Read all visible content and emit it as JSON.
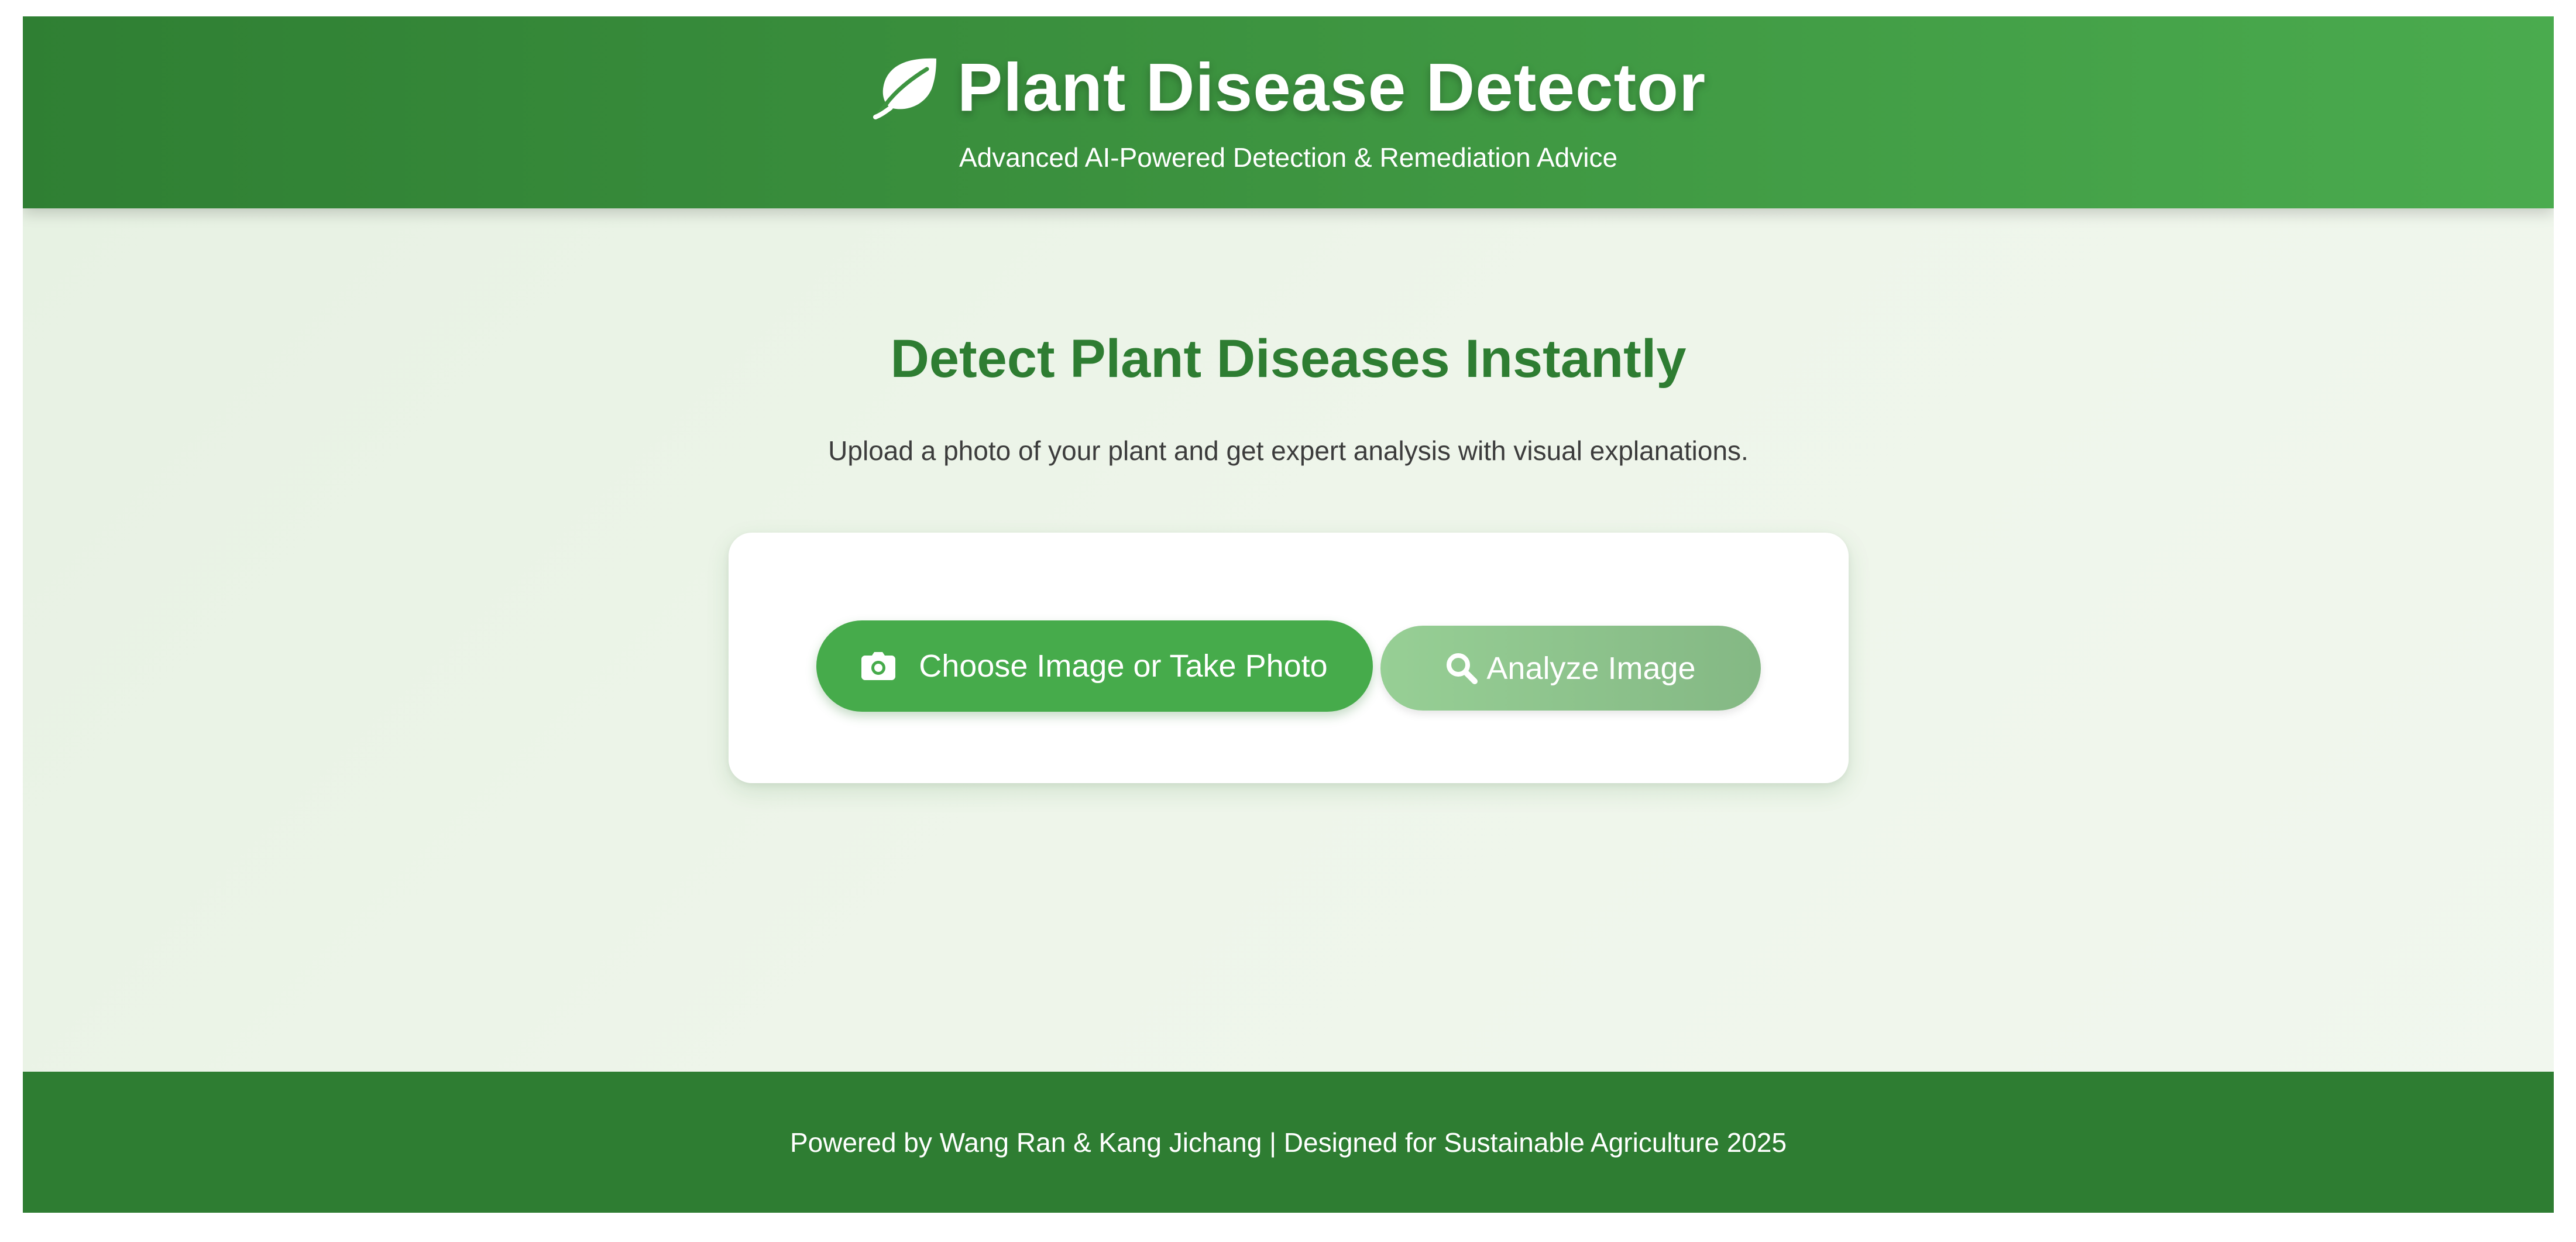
{
  "header": {
    "icon": "leaf-icon",
    "title": "Plant Disease Detector",
    "subtitle": "Advanced AI-Powered Detection & Remediation Advice"
  },
  "hero": {
    "title": "Detect Plant Diseases Instantly",
    "description": "Upload a photo of your plant and get expert analysis with visual explanations."
  },
  "upload": {
    "choose_button": {
      "icon": "camera-icon",
      "label": "Choose Image or Take Photo"
    },
    "analyze_button": {
      "icon": "search-icon",
      "label": "Analyze Image",
      "state": "disabled"
    }
  },
  "footer": {
    "text": "Powered by Wang Ran & Kang Jichang | Designed for Sustainable Agriculture 2025"
  },
  "colors": {
    "header_gradient_start": "#2f7f33",
    "header_gradient_end": "#4aab4e",
    "primary_green": "#2e7d32",
    "button_green": "#46ab4b",
    "disabled_button_start": "#97cf95",
    "disabled_button_end": "#84b884",
    "background": "#eaf4e6"
  }
}
